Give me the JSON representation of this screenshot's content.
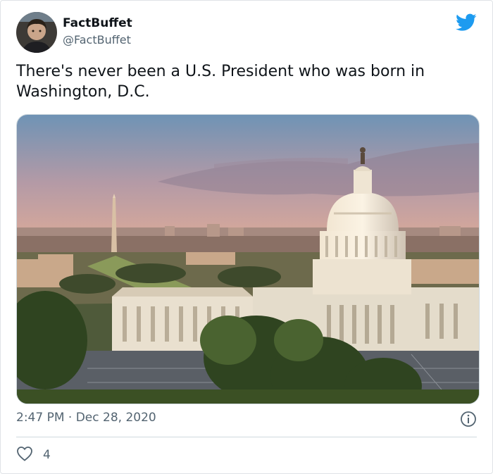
{
  "author": {
    "name": "FactBuffet",
    "handle": "@FactBuffet",
    "avatar_icon": "avatar-photo"
  },
  "brand_icon": "twitter-bird-icon",
  "tweet": {
    "text": "There's never been a U.S. President who was born in Washington, D.C.",
    "image_subject": "aerial-city-capitol-photo",
    "time": "2:47 PM",
    "separator": "·",
    "date": "Dec 28, 2020"
  },
  "actions": {
    "likes": "4",
    "like_icon": "heart-icon",
    "info_icon": "info-icon"
  },
  "colors": {
    "brand": "#1d9bf0",
    "text": "#0f1419",
    "muted": "#536471",
    "border": "#cfd9de"
  }
}
